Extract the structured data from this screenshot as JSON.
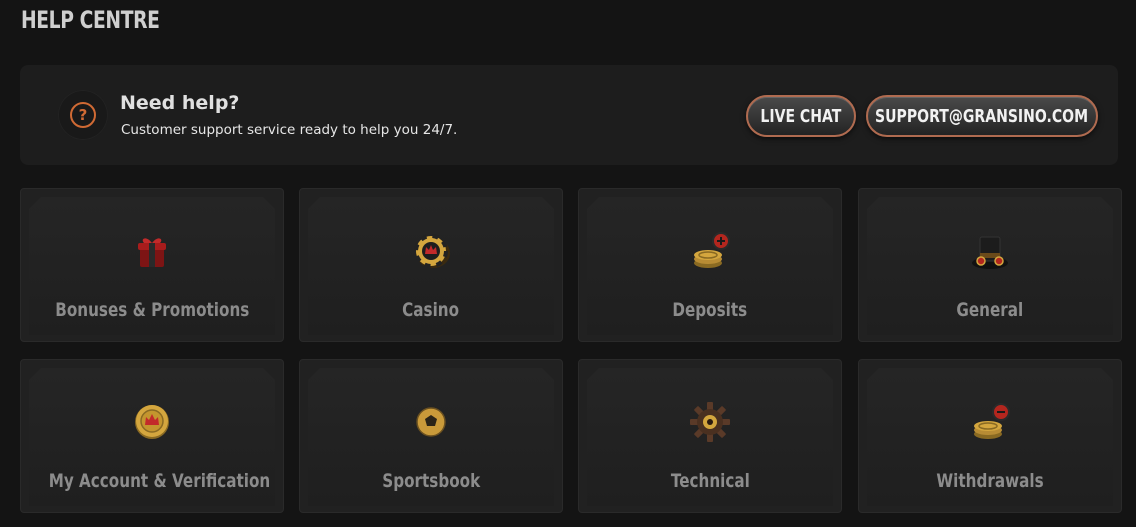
{
  "page": {
    "title": "HELP CENTRE"
  },
  "help_banner": {
    "heading": "Need help?",
    "subtitle": "Customer support service ready to help you 24/7.",
    "icon": "question-circle-icon",
    "live_chat_label": "LIVE CHAT",
    "email_label": "SUPPORT@GRANSINO.COM"
  },
  "categories": [
    {
      "label": "Bonuses & Promotions",
      "icon": "gift-box-icon"
    },
    {
      "label": "Casino",
      "icon": "casino-chip-icon"
    },
    {
      "label": "Deposits",
      "icon": "coins-plus-icon"
    },
    {
      "label": "General",
      "icon": "top-hat-icon"
    },
    {
      "label": "My Account & Verification",
      "icon": "crown-coin-icon"
    },
    {
      "label": "Sportsbook",
      "icon": "soccer-ball-icon"
    },
    {
      "label": "Technical",
      "icon": "gear-icon"
    },
    {
      "label": "Withdrawals",
      "icon": "coins-minus-icon"
    }
  ],
  "colors": {
    "background": "#141414",
    "accent": "#d06a34",
    "gold": "#c9a24a",
    "red": "#b3261e"
  }
}
